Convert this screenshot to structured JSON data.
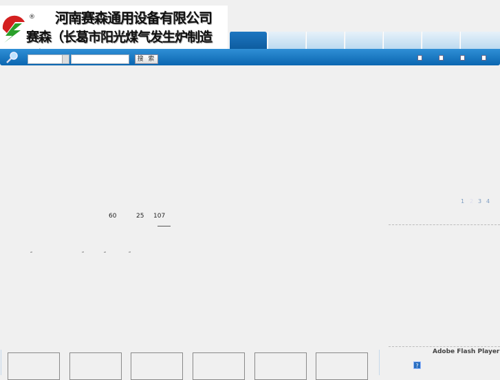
{
  "logo": {
    "title": "河南赛森通用设备有限公司",
    "subtitle": "赛森（长葛市阳光煤气发生炉制造厂）",
    "mark": "®"
  },
  "search": {
    "button_label": "搜 索",
    "input_value": "",
    "select_value": ""
  },
  "counts": {
    "a": "60",
    "b": "25",
    "c": "107"
  },
  "quotes": [
    "“",
    "”",
    "“",
    "”"
  ],
  "pager": [
    "1",
    "2",
    "3",
    "4"
  ],
  "flash": {
    "label": "Adobe Flash Player",
    "help_icon": "?"
  },
  "colors": {
    "nav_blue": "#0b66b0",
    "tab_light": "#bcdaf0"
  }
}
